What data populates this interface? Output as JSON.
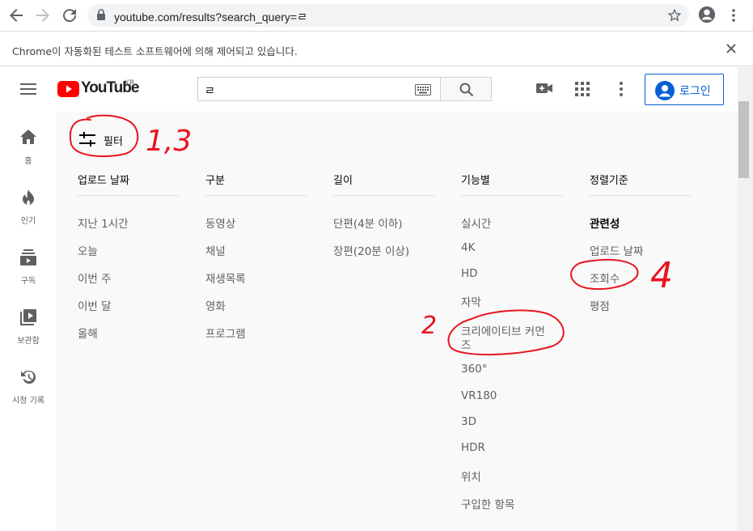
{
  "browser": {
    "url": "youtube.com/results?search_query=ㄹ",
    "automation_notice": "Chrome이 자동화된 테스트 소프트웨어에 의해 제어되고 있습니다."
  },
  "header": {
    "logo_text": "YouTube",
    "logo_region": "KR",
    "search_query": "ㄹ",
    "login_label": "로그인"
  },
  "sidebar": {
    "items": [
      {
        "label": "홈"
      },
      {
        "label": "인기"
      },
      {
        "label": "구독"
      },
      {
        "label": "보관함"
      },
      {
        "label": "시청 기록"
      }
    ]
  },
  "filter": {
    "title": "필터",
    "columns": [
      {
        "header": "업로드 날짜",
        "options": [
          "지난 1시간",
          "오늘",
          "이번 주",
          "이번 달",
          "올해"
        ]
      },
      {
        "header": "구분",
        "options": [
          "동영상",
          "채널",
          "재생목록",
          "영화",
          "프로그램"
        ]
      },
      {
        "header": "길이",
        "options": [
          "단편(4분 이하)",
          "장편(20분 이상)"
        ]
      },
      {
        "header": "기능별",
        "options": [
          "실시간",
          "4K",
          "HD",
          "자막",
          "크리에이티브 커먼",
          "즈",
          "360°",
          "VR180",
          "3D",
          "HDR",
          "위치",
          "구입한 항목"
        ]
      },
      {
        "header": "정렬기준",
        "options": [
          "관련성",
          "업로드 날짜",
          "조회수",
          "평점"
        ],
        "selected": "관련성"
      }
    ]
  },
  "annotations": {
    "mark1": "1,3",
    "mark2": "2",
    "mark4": "4",
    "color": "#e8141e"
  }
}
